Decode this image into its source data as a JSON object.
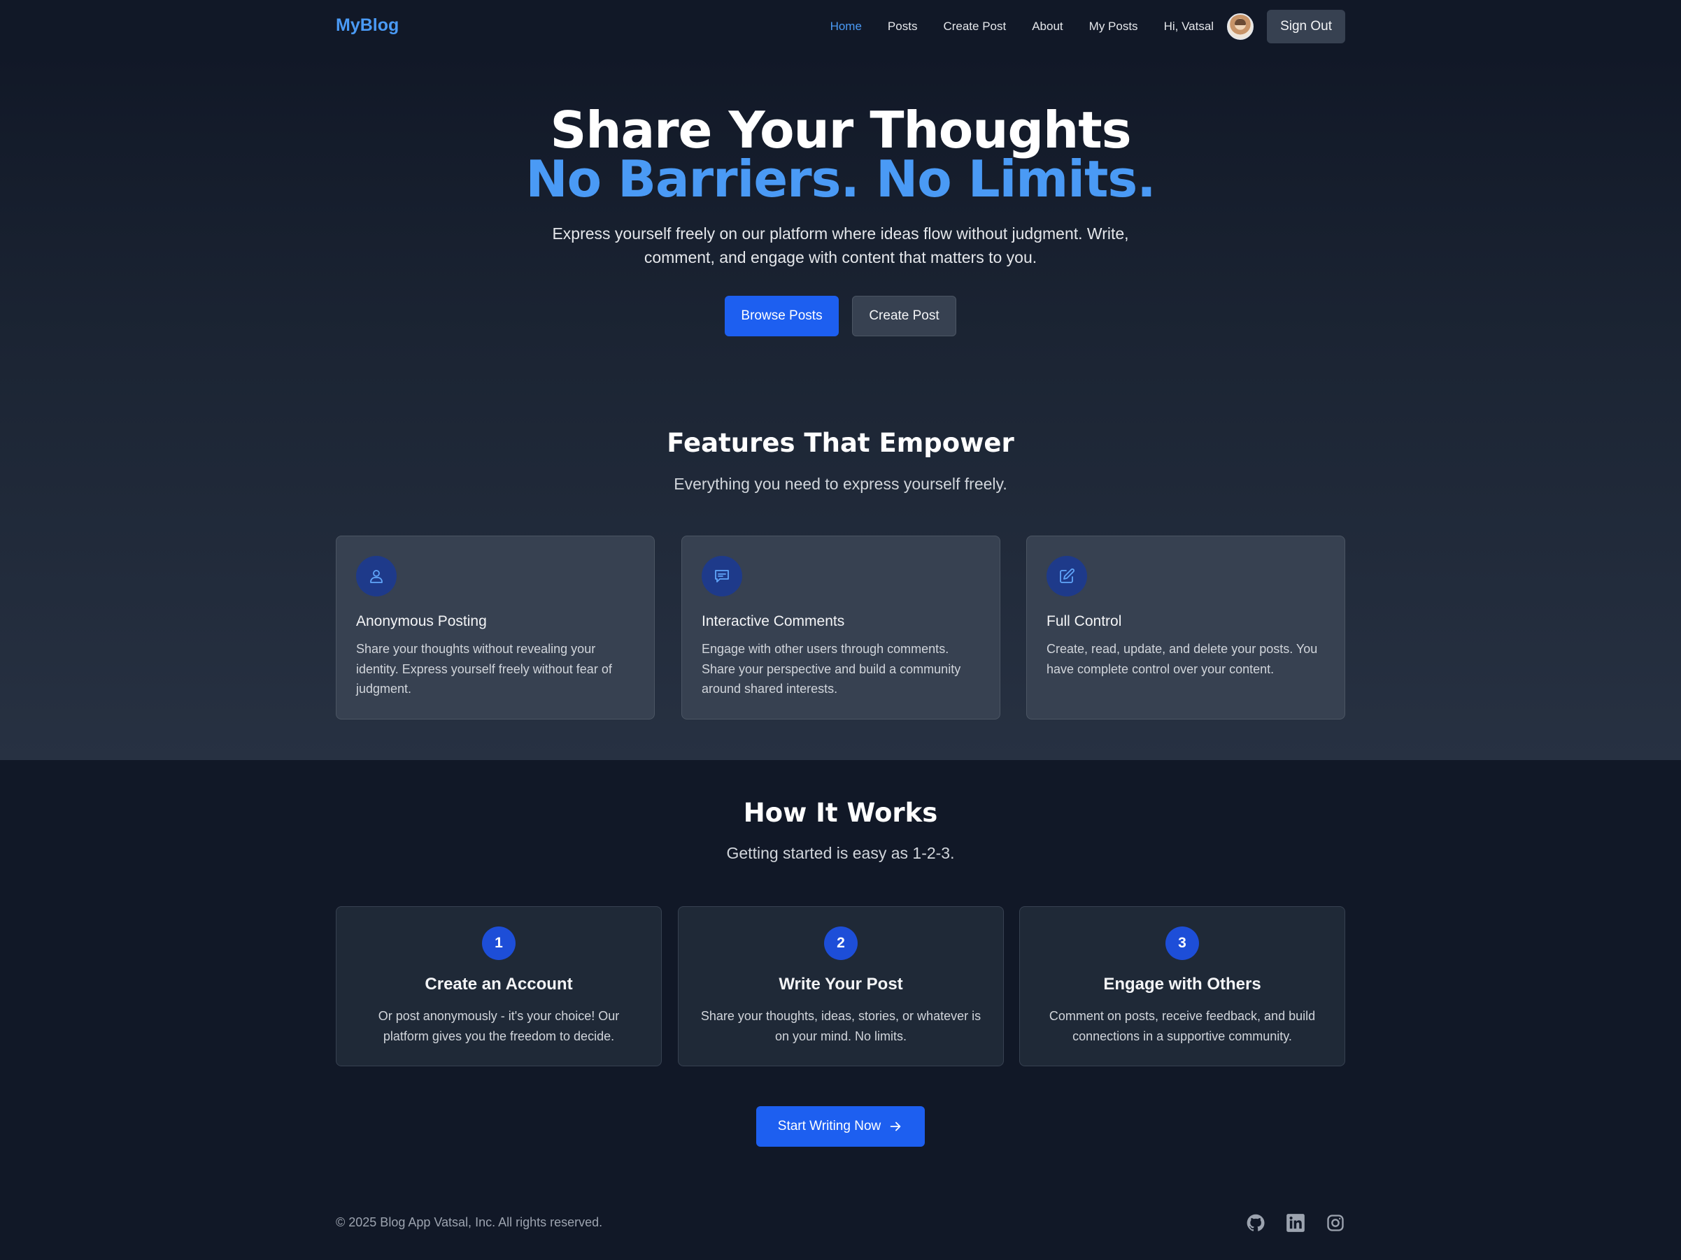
{
  "nav": {
    "brand": "MyBlog",
    "links": [
      "Home",
      "Posts",
      "Create Post",
      "About",
      "My Posts"
    ],
    "greeting": "Hi, Vatsal",
    "sign_out": "Sign Out"
  },
  "hero": {
    "title_line1": "Share Your Thoughts",
    "title_line2": "No Barriers. No Limits.",
    "subtitle": "Express yourself freely on our platform where ideas flow without judgment. Write, comment, and engage with content that matters to you.",
    "browse_button": "Browse Posts",
    "create_button": "Create Post"
  },
  "features": {
    "title": "Features That Empower",
    "subtitle": "Everything you need to express yourself freely.",
    "cards": [
      {
        "icon": "user-icon",
        "title": "Anonymous Posting",
        "desc": "Share your thoughts without revealing your identity. Express yourself freely without fear of judgment."
      },
      {
        "icon": "chat-icon",
        "title": "Interactive Comments",
        "desc": "Engage with other users through comments. Share your perspective and build a community around shared interests."
      },
      {
        "icon": "edit-icon",
        "title": "Full Control",
        "desc": "Create, read, update, and delete your posts. You have complete control over your content."
      }
    ]
  },
  "how": {
    "title": "How It Works",
    "subtitle": "Getting started is easy as 1-2-3.",
    "steps": [
      {
        "num": "1",
        "title": "Create an Account",
        "desc": "Or post anonymously - it's your choice! Our platform gives you the freedom to decide."
      },
      {
        "num": "2",
        "title": "Write Your Post",
        "desc": "Share your thoughts, ideas, stories, or whatever is on your mind. No limits."
      },
      {
        "num": "3",
        "title": "Engage with Others",
        "desc": "Comment on posts, receive feedback, and build connections in a supportive community."
      }
    ],
    "cta": "Start Writing Now"
  },
  "footer": {
    "copyright": "© 2025 Blog App Vatsal, Inc. All rights reserved.",
    "social": [
      "github-icon",
      "linkedin-icon",
      "instagram-icon"
    ]
  },
  "colors": {
    "background": "#111827",
    "accent": "#4a9af5",
    "primary_button": "#1d5ff0",
    "card": "#374151"
  }
}
